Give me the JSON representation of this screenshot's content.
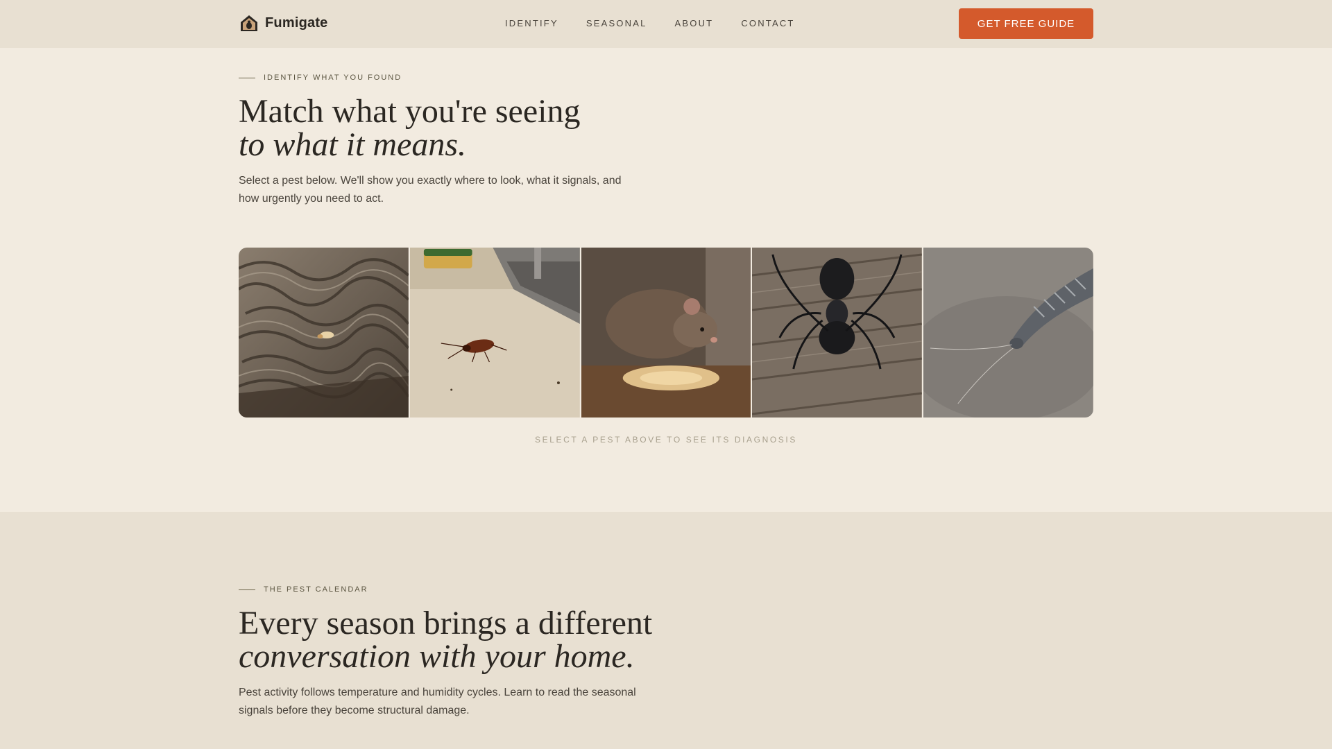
{
  "brand": {
    "name": "Fumigate",
    "icon": "house-bug-icon"
  },
  "nav": {
    "items": [
      "IDENTIFY",
      "SEASONAL",
      "ABOUT",
      "CONTACT"
    ]
  },
  "header": {
    "cta_label": "GET FREE GUIDE"
  },
  "identify": {
    "eyebrow": "IDENTIFY WHAT YOU FOUND",
    "title_line1": "Match what you're seeing",
    "title_line2": "to what it means.",
    "lead": "Select a pest below. We'll show you exactly where to look, what it signals, and how urgently you need to act.",
    "hint": "SELECT A PEST ABOVE TO SEE ITS DIAGNOSIS"
  },
  "pests": [
    "termite",
    "cockroach",
    "rat",
    "carpenter-ant",
    "silverfish"
  ],
  "calendar": {
    "eyebrow": "THE PEST CALENDAR",
    "title_line1": "Every season brings a different",
    "title_line2": "conversation with your home.",
    "lead": "Pest activity follows temperature and humidity cycles. Learn to read the seasonal signals before they become structural damage."
  },
  "colors": {
    "accent": "#d45a2c",
    "header_bg": "#e8e0d2",
    "page_bg": "#f2ebe0"
  }
}
